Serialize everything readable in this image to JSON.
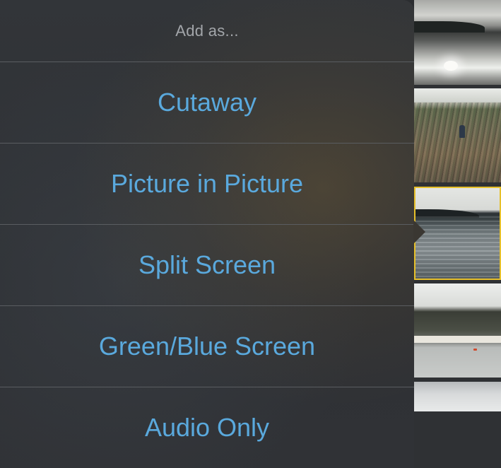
{
  "popover": {
    "header": "Add as...",
    "items": [
      {
        "label": "Cutaway"
      },
      {
        "label": "Picture in Picture"
      },
      {
        "label": "Split Screen"
      },
      {
        "label": "Green/Blue Screen"
      },
      {
        "label": "Audio Only"
      }
    ]
  },
  "thumbnails": {
    "count": 5,
    "selected_index": 2,
    "selected_color": "#e6c02b"
  },
  "colors": {
    "menu_text": "#5aa9dd",
    "header_text": "#a3a6aa",
    "divider": "#5a5d61",
    "popover_bg": "#303236"
  }
}
